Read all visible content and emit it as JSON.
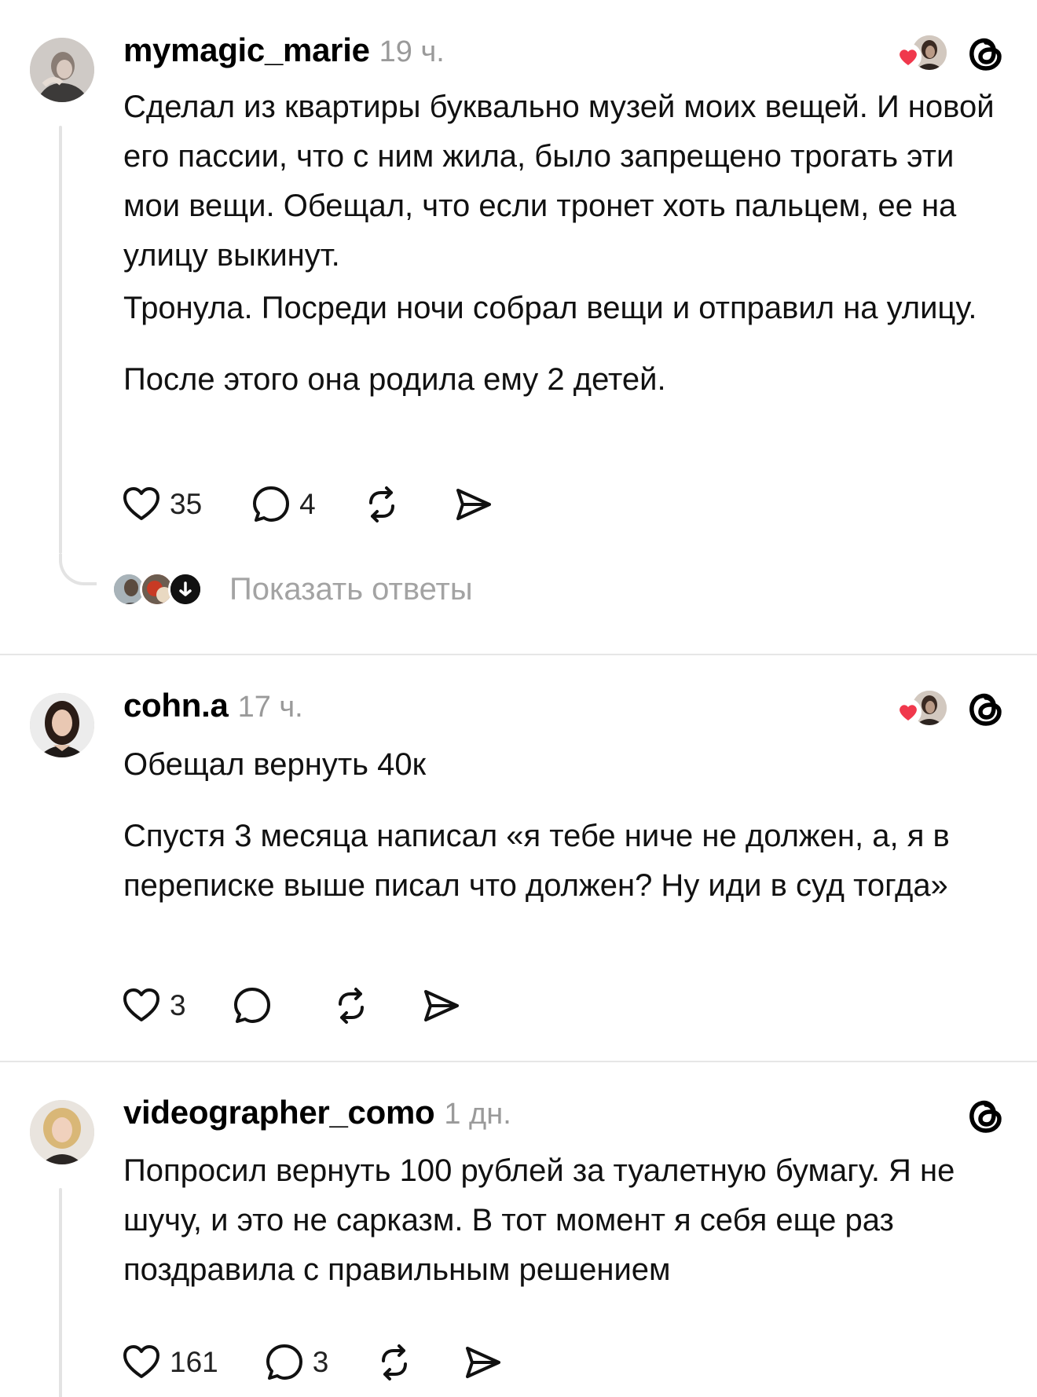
{
  "posts": [
    {
      "username": "mymagic_marie",
      "time": "19 ч.",
      "paragraphs": [
        "Сделал из квартиры буквально музей моих вещей. И новой его пассии, что с ним жила, было запрещено трогать эти мои вещи. Обещал, что если тронет хоть пальцем, ее на улицу выкинут.",
        "Тронула. Посреди ночи собрал вещи и отправил на улицу.",
        "После этого она родила ему 2 детей."
      ],
      "likes": "35",
      "replies": "4",
      "show_replies_label": "Показать ответы"
    },
    {
      "username": "cohn.a",
      "time": "17 ч.",
      "paragraphs": [
        "Обещал вернуть 40к",
        "Спустя 3 месяца написал «я тебе ниче не должен, а, я в переписке выше писал что должен? Ну иди в суд тогда»"
      ],
      "likes": "3",
      "replies": ""
    },
    {
      "username": "videographer_como",
      "time": "1 дн.",
      "paragraphs": [
        "Попросил вернуть 100 рублей за туалетную бумагу. Я не шучу, и это не сарказм. В тот момент я себя еще раз поздравила с правильным решением"
      ],
      "likes": "161",
      "replies": "3"
    }
  ],
  "icons": {
    "like": "heart-outline-icon",
    "reply": "comment-bubble-icon",
    "repost": "repost-arrows-icon",
    "share": "paper-plane-icon",
    "brand": "threads-logo-icon",
    "liked_badge": "red-heart-icon",
    "expand": "arrow-down-icon"
  },
  "colors": {
    "liked_heart": "#f0384c",
    "muted_text": "#9a9a9a",
    "thread_line": "#e3e3e3"
  }
}
